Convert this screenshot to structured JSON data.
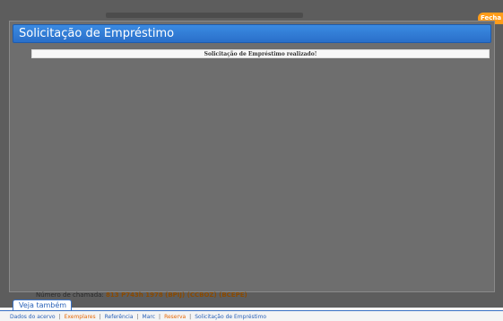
{
  "close_tab": {
    "label": "Fecha"
  },
  "dialog": {
    "title": "Solicitação de Empréstimo",
    "message": "Solicitação de Empréstimo realizado!"
  },
  "record": {
    "call_number_label": "Número de chamada:",
    "call_number_value": "813 P743h 1978 (BPIJ) (CCBOZ) (BCEPE)"
  },
  "see_also": {
    "tab_label": "Veja também",
    "links": [
      {
        "label": "Dados do acervo",
        "accent": false
      },
      {
        "label": "Exemplares",
        "accent": true
      },
      {
        "label": "Referência",
        "accent": false
      },
      {
        "label": "Marc",
        "accent": false
      },
      {
        "label": "Reserva",
        "accent": true
      },
      {
        "label": "Solicitação de Empréstimo",
        "accent": false
      }
    ]
  },
  "colors": {
    "title_bar": "#2f7bd6",
    "accent_link": "#e56a0a",
    "link": "#2a62b8",
    "close_tab": "#ff9c1a"
  }
}
